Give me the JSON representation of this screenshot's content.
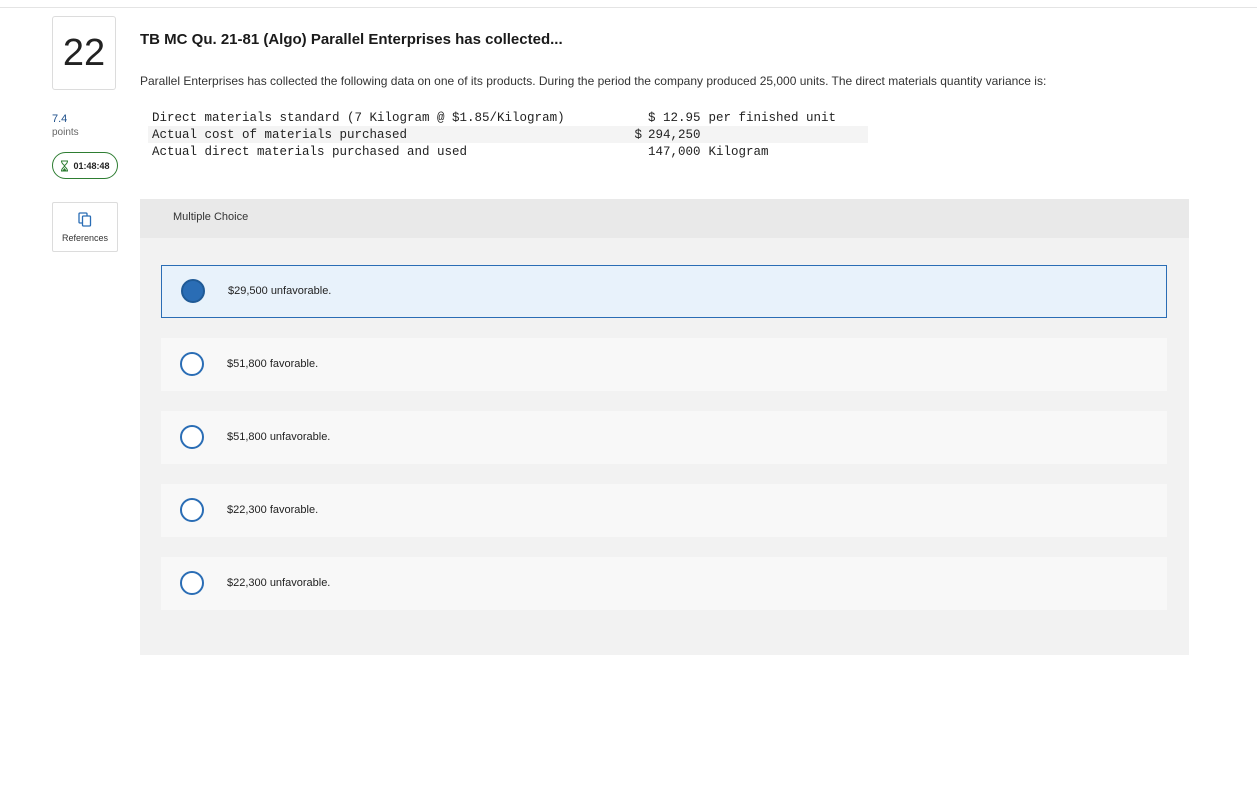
{
  "question": {
    "number": "22",
    "points_value": "7.4",
    "points_label": "points",
    "timer": "01:48:48",
    "references_label": "References",
    "title": "TB MC Qu. 21-81 (Algo) Parallel Enterprises has collected...",
    "prompt": "Parallel Enterprises has collected the following data on one of its products. During the period the company produced 25,000 units. The direct materials quantity variance is:"
  },
  "data_table": {
    "rows": [
      {
        "label": "Direct materials standard (7 Kilogram @ $1.85/Kilogram)",
        "currency": "",
        "value": "$ 12.95",
        "unit": "per finished unit"
      },
      {
        "label": "Actual cost of materials purchased",
        "currency": "$",
        "value": "294,250",
        "unit": ""
      },
      {
        "label": "Actual direct materials purchased and used",
        "currency": "",
        "value": "147,000",
        "unit": "Kilogram"
      }
    ]
  },
  "multiple_choice": {
    "header": "Multiple Choice",
    "options": [
      {
        "label": "$29,500 unfavorable.",
        "selected": true
      },
      {
        "label": "$51,800 favorable.",
        "selected": false
      },
      {
        "label": "$51,800 unfavorable.",
        "selected": false
      },
      {
        "label": "$22,300 favorable.",
        "selected": false
      },
      {
        "label": "$22,300 unfavorable.",
        "selected": false
      }
    ]
  },
  "colors": {
    "accent": "#2a6db5",
    "timer_border": "#2e7d32",
    "selected_bg": "#e8f2fb"
  },
  "icons": {
    "timer": "hourglass-icon",
    "references": "copy-pages-icon"
  }
}
